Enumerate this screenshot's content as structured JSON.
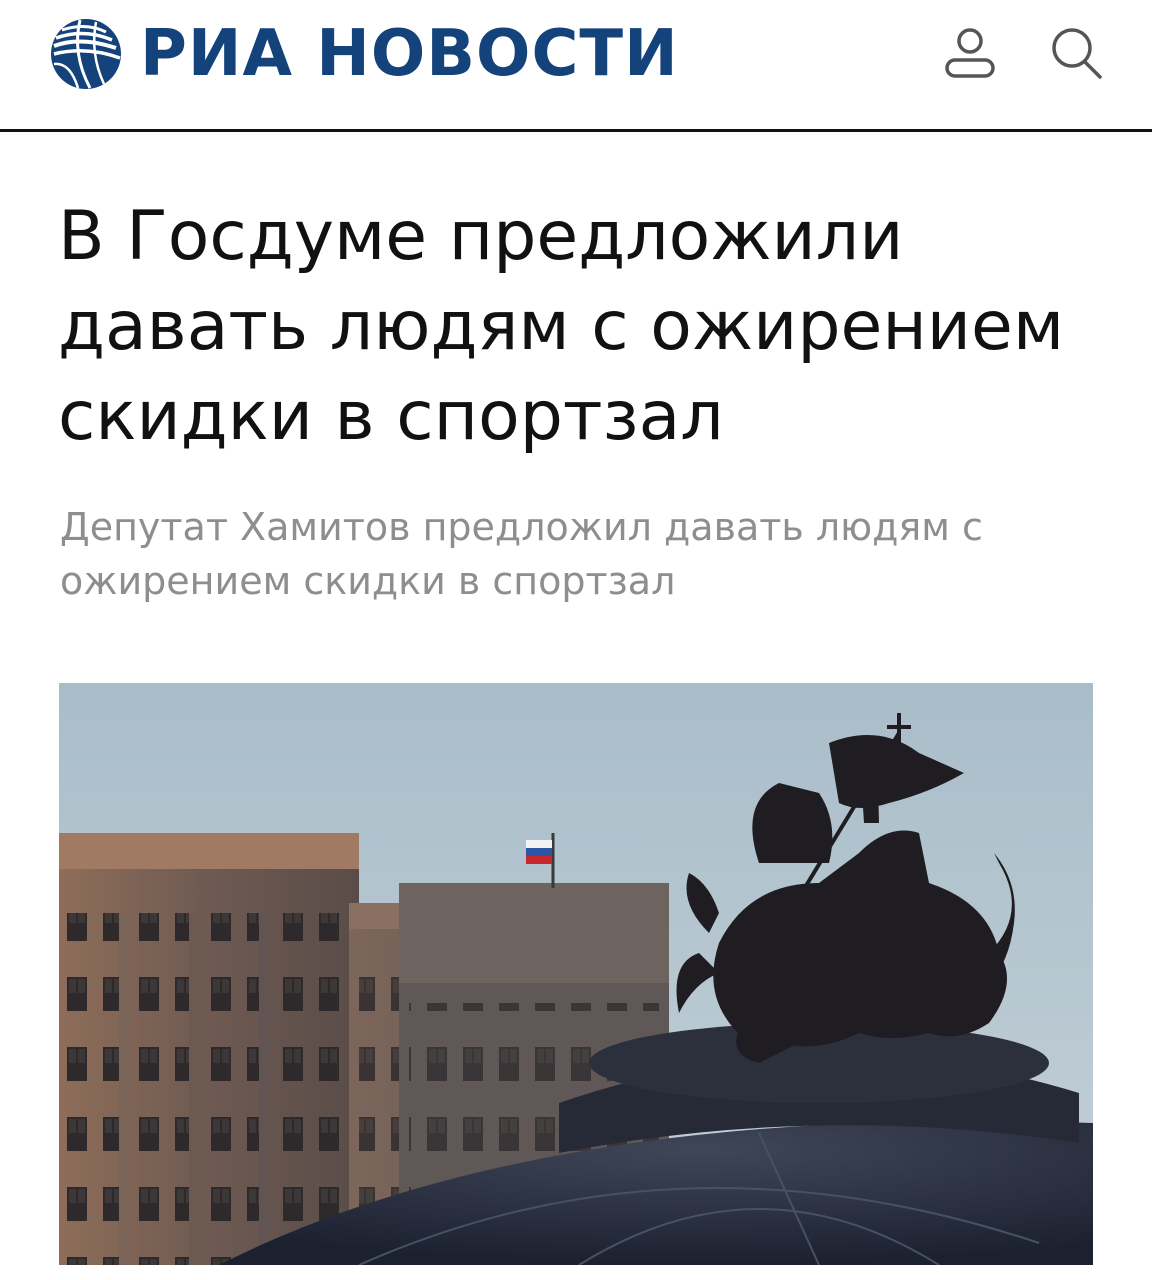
{
  "header": {
    "logo_text": "РИА НОВОСТИ",
    "brand_color": "#14427a",
    "icons": [
      "user-icon",
      "search-icon"
    ]
  },
  "article": {
    "title": "В Госдуме предложили давать людям с ожирением скидки в спортзал",
    "subtitle": "Депутат Хамитов предложил давать людям с ожирением скидки в спортзал"
  },
  "photo": {
    "subject": "state-duma-building-and-st-george-statue"
  }
}
